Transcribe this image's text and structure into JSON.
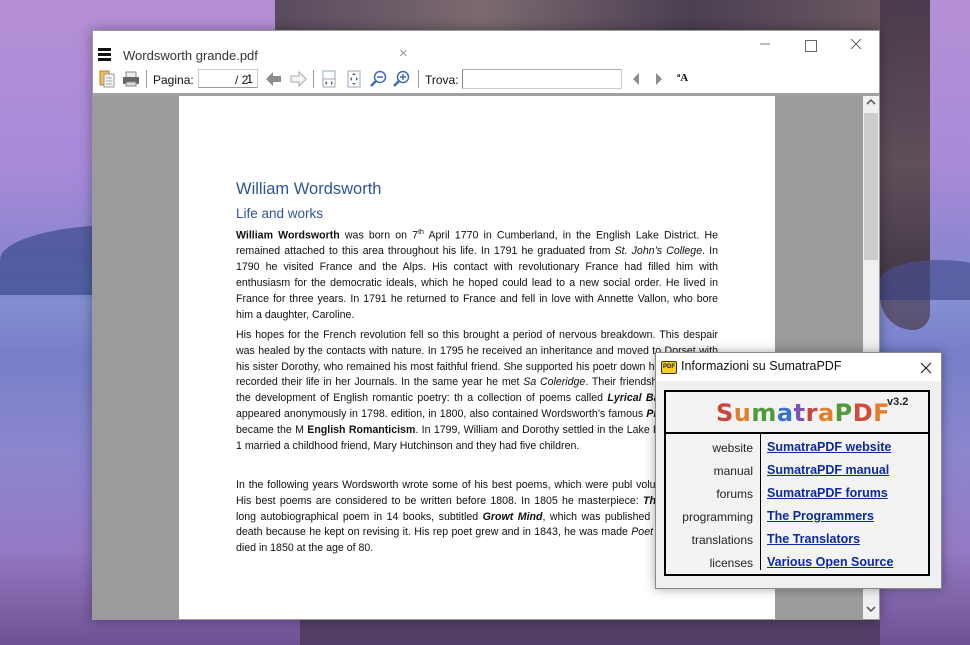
{
  "window": {
    "tab_title": "Wordsworth grande.pdf",
    "tab_close": "×",
    "minimize": "—",
    "close": "✕"
  },
  "toolbar": {
    "page_label": "Pagina:",
    "page_current": "1",
    "page_total": "/ 2",
    "find_label": "Trova:",
    "find_value": "",
    "match_case_glyph": "ªA"
  },
  "document": {
    "title": "William Wordsworth",
    "subtitle": "Life and works",
    "paragraphs": [
      {
        "lead_bold": "William Wordsworth",
        "t1": " was born on 7",
        "sup": "th",
        "t2": " April 1770 in Cumberland, in the English Lake District. He remained attached to this area throughout his life. In 1791 he graduated from ",
        "i1": "St. John’s College",
        "t3": ". In 1790 he visited France and the Alps. His contact with revolutionary France had filled him with enthusiasm for the democratic ideals, which he hoped could lead to a new social order. He lived in France for three years. In 1791 he returned to France and fell in love with Annette Vallon, who bore him a daughter, Caroline."
      },
      {
        "t1": "His hopes for the French revolution fell so this brought a period of nervous breakdown. This despair was healed by the contacts with nature. In 1795 he received an inheritance and moved to Dorset with his sister Dorothy, who remained his most faithful friend. She supported his poetr down his poems and recorded their life in her Journals. In the same year he met ",
        "i1": "Sa Coleridge",
        "t2": ". Their friendship brought to the development of English romantic poetry: th a collection of poems called ",
        "bi1": "Lyrical Ballads",
        "t3": ", which appeared anonymously in 1798. edition, in 1800, also contained Wordsworth’s famous ",
        "bi2": "Preface",
        "t4": ", which became the M ",
        "b1": "English Romanticism",
        "t5": ". In 1799, William and Dorothy settled in the Lake District and in 1 married a childhood friend, Mary Hutchinson and they had five children."
      },
      {
        "t1": "In the following years Wordsworth wrote some of his best poems, which were publ volumes in 1807. His best poems are considered to be written before 1808. In 1805 he masterpiece: ",
        "bi1": "The Prelude",
        "t2": ", a long autobiographical poem in 14 books, subtitled ",
        "bi2": "Growt Mind",
        "t3": ", which was published only after his death because he kept on revising it. His rep poet grew and in 1843, he was made ",
        "i1": "Poet Laureate",
        "t4": ". He died in 1850 at the age of 80."
      }
    ]
  },
  "about_dialog": {
    "title": "Informazioni su SumatraPDF",
    "icon_text": "PDF",
    "close": "✕",
    "logo_letters": [
      {
        "ch": "S",
        "color": "#c8453b"
      },
      {
        "ch": "u",
        "color": "#e0802a"
      },
      {
        "ch": "m",
        "color": "#4f9a3c"
      },
      {
        "ch": "a",
        "color": "#3c72c8"
      },
      {
        "ch": "t",
        "color": "#7b55b8"
      },
      {
        "ch": "r",
        "color": "#c8453b"
      },
      {
        "ch": "a",
        "color": "#e0802a"
      },
      {
        "ch": "P",
        "color": "#4f9a3c"
      },
      {
        "ch": "D",
        "color": "#d24a3a"
      },
      {
        "ch": "F",
        "color": "#e37d2a"
      }
    ],
    "version": "v3.2",
    "links": [
      {
        "key": "website",
        "value": "SumatraPDF website"
      },
      {
        "key": "manual",
        "value": "SumatraPDF manual"
      },
      {
        "key": "forums",
        "value": "SumatraPDF forums"
      },
      {
        "key": "programming",
        "value": "The Programmers"
      },
      {
        "key": "translations",
        "value": "The Translators"
      },
      {
        "key": "licenses",
        "value": "Various Open Source"
      }
    ],
    "link_color": "#0b2aa0"
  }
}
